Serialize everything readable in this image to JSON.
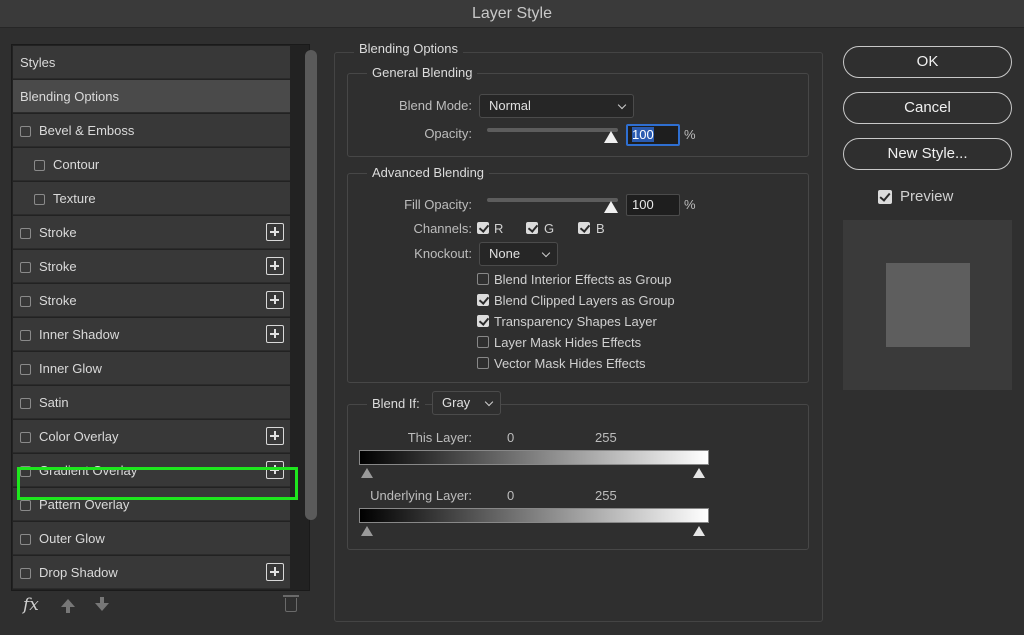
{
  "window": {
    "title": "Layer Style"
  },
  "styles_panel": {
    "items": [
      {
        "label": "Styles",
        "checkbox": false,
        "plus": false,
        "indent": 0
      },
      {
        "label": "Blending Options",
        "checkbox": false,
        "plus": false,
        "indent": 0,
        "selected": true
      },
      {
        "label": "Bevel & Emboss",
        "checkbox": true,
        "plus": false,
        "indent": 0
      },
      {
        "label": "Contour",
        "checkbox": true,
        "plus": false,
        "indent": 1
      },
      {
        "label": "Texture",
        "checkbox": true,
        "plus": false,
        "indent": 1
      },
      {
        "label": "Stroke",
        "checkbox": true,
        "plus": true,
        "indent": 0
      },
      {
        "label": "Stroke",
        "checkbox": true,
        "plus": true,
        "indent": 0
      },
      {
        "label": "Stroke",
        "checkbox": true,
        "plus": true,
        "indent": 0
      },
      {
        "label": "Inner Shadow",
        "checkbox": true,
        "plus": true,
        "indent": 0
      },
      {
        "label": "Inner Glow",
        "checkbox": true,
        "plus": false,
        "indent": 0
      },
      {
        "label": "Satin",
        "checkbox": true,
        "plus": false,
        "indent": 0
      },
      {
        "label": "Color Overlay",
        "checkbox": true,
        "plus": true,
        "indent": 0,
        "highlighted": true
      },
      {
        "label": "Gradient Overlay",
        "checkbox": true,
        "plus": true,
        "indent": 0
      },
      {
        "label": "Pattern Overlay",
        "checkbox": true,
        "plus": false,
        "indent": 0
      },
      {
        "label": "Outer Glow",
        "checkbox": true,
        "plus": false,
        "indent": 0
      },
      {
        "label": "Drop Shadow",
        "checkbox": true,
        "plus": true,
        "indent": 0
      }
    ],
    "footer": {
      "fx_label": "fx"
    },
    "highlight_color": "#1ee61e"
  },
  "blending_options": {
    "title": "Blending Options",
    "general": {
      "title": "General Blending",
      "blend_mode_label": "Blend Mode:",
      "blend_mode_value": "Normal",
      "opacity_label": "Opacity:",
      "opacity_value": "100",
      "opacity_unit": "%"
    },
    "advanced": {
      "title": "Advanced Blending",
      "fill_opacity_label": "Fill Opacity:",
      "fill_opacity_value": "100",
      "fill_opacity_unit": "%",
      "channels_label": "Channels:",
      "channels": [
        {
          "label": "R",
          "checked": true
        },
        {
          "label": "G",
          "checked": true
        },
        {
          "label": "B",
          "checked": true
        }
      ],
      "knockout_label": "Knockout:",
      "knockout_value": "None",
      "options": [
        {
          "label": "Blend Interior Effects as Group",
          "checked": false
        },
        {
          "label": "Blend Clipped Layers as Group",
          "checked": true
        },
        {
          "label": "Transparency Shapes Layer",
          "checked": true
        },
        {
          "label": "Layer Mask Hides Effects",
          "checked": false
        },
        {
          "label": "Vector Mask Hides Effects",
          "checked": false
        }
      ]
    },
    "blend_if": {
      "title": "Blend If:",
      "value": "Gray",
      "this_layer_label": "This Layer:",
      "this_layer_min": "0",
      "this_layer_max": "255",
      "underlying_label": "Underlying Layer:",
      "underlying_min": "0",
      "underlying_max": "255"
    }
  },
  "buttons": {
    "ok": "OK",
    "cancel": "Cancel",
    "new_style": "New Style..."
  },
  "preview": {
    "label": "Preview",
    "checked": true
  }
}
